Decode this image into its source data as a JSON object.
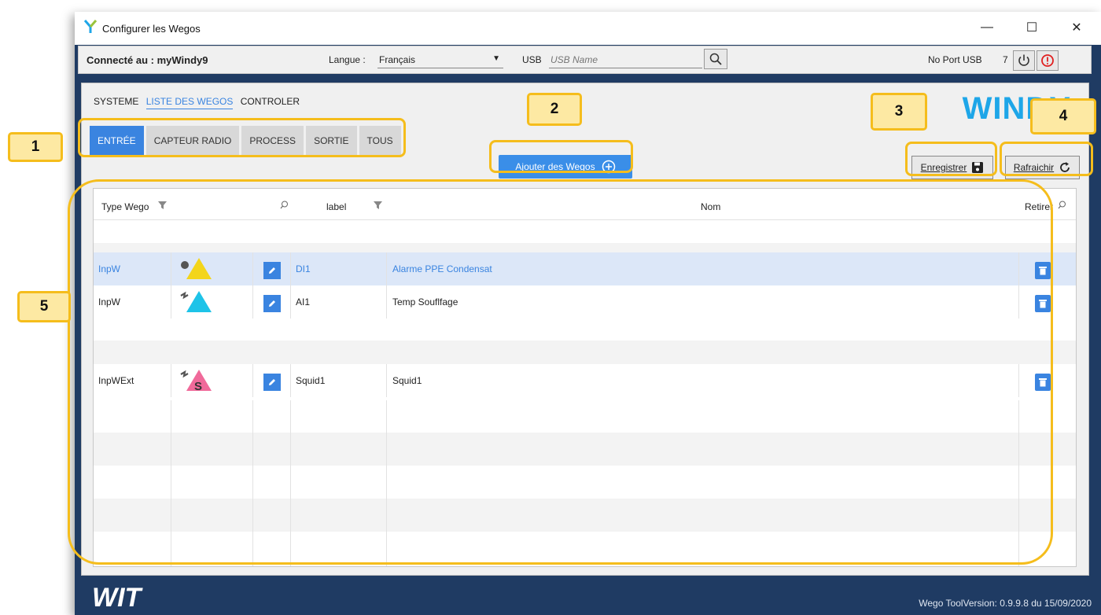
{
  "window": {
    "title": "Configurer les Wegos",
    "controls": {
      "minimize": "—",
      "maximize": "☐",
      "close": "✕"
    }
  },
  "topbar": {
    "connection": "Connecté au : myWindy9",
    "language_label": "Langue :",
    "language_value": "Français",
    "usb_label": "USB",
    "usb_placeholder": "USB Name",
    "no_port_label": "No Port USB",
    "port_value": "7"
  },
  "nav": {
    "items": [
      "SYSTEME",
      "LISTE DES WEGOS",
      "CONTROLER"
    ],
    "active": "LISTE DES WEGOS"
  },
  "brand": "WINDY",
  "categories": {
    "tabs": [
      "ENTRÉE",
      "CAPTEUR RADIO",
      "PROCESS",
      "SORTIE",
      "TOUS"
    ],
    "active": "ENTRÉE"
  },
  "buttons": {
    "add": "Ajouter des Wegos",
    "save": "Enregistrer",
    "refresh": "Rafraichir"
  },
  "grid": {
    "columns": {
      "type": "Type Wego",
      "label": "label",
      "name": "Nom",
      "remove": "Retirer"
    },
    "rows": [
      {
        "type": "InpW",
        "label": "DI1",
        "name": "Alarme PPE Condensat",
        "icon": "digital-input-triangle-icon",
        "selected": true
      },
      {
        "type": "InpW",
        "label": "AI1",
        "name": "Temp Souflfage",
        "icon": "analog-input-triangle-icon",
        "selected": false
      },
      {
        "type": "InpWExt",
        "label": "Squid1",
        "name": "Squid1",
        "icon": "squid-triangle-icon",
        "selected": false
      }
    ]
  },
  "footer": {
    "version": "Wego ToolVersion: 0.9.9.8 du 15/09/2020",
    "logo": "WIT"
  },
  "callouts": [
    "1",
    "2",
    "3",
    "4",
    "5"
  ],
  "colors": {
    "accent": "#3a84e0",
    "callout_border": "#f5bd1c",
    "callout_fill": "#fde9a3",
    "brand": "#1ea6e8",
    "window_bg": "#1f3b63"
  }
}
